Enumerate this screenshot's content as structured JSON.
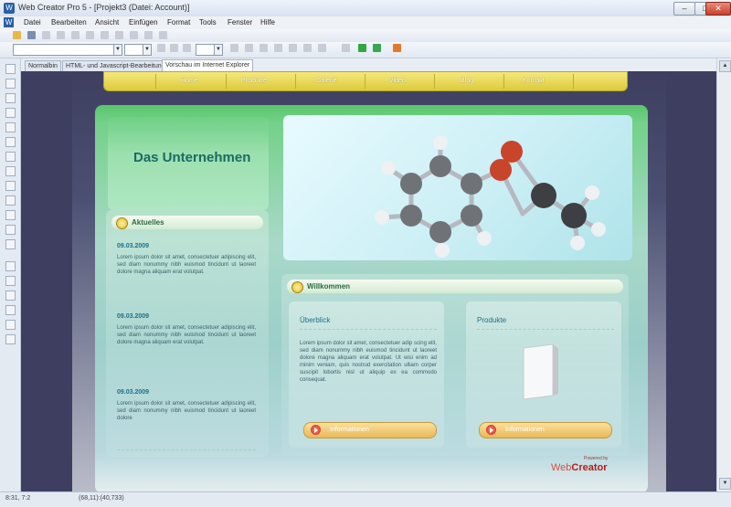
{
  "window": {
    "title": "Web Creator Pro 5 - [Projekt3 (Datei: Account)]",
    "minimize": "–",
    "maximize": "□",
    "close": "✕"
  },
  "menu": [
    "Datei",
    "Bearbeiten",
    "Ansicht",
    "Einfügen",
    "Format",
    "Tools",
    "Fenster",
    "Hilfe"
  ],
  "tabs": [
    "Normalbin",
    "HTML- und Javascript-Bearbeitung",
    "Vorschau im Internet Explorer"
  ],
  "site": {
    "nav": [
      "Home",
      "Produkte",
      "Galerie",
      "Video",
      "Blog",
      "Kontakt"
    ],
    "company_title": "Das Unternehmen",
    "news_heading": "Aktuelles",
    "news": [
      {
        "date": "09.03.2009",
        "text": "Lorem ipsum dolor sit amet, consectetuer adipiscing elit, sed diam nonummy nibh euismod tincidunt ut laoreet dolore magna aliquam erat volutpat."
      },
      {
        "date": "09.03.2009",
        "text": "Lorem ipsum dolor sit amet, consectetuer adipiscing elit, sed diam nonummy nibh euismod tincidunt ut laoreet dolore magna aliquam erat volutpat."
      },
      {
        "date": "09.03.2009",
        "text": "Lorem ipsum dolor sit amet, consectetuer adipiscing elit, sed diam nonummy nibh euismod tincidunt ut laoreet dolore"
      }
    ],
    "welcome_heading": "Willkommen",
    "overview": {
      "title": "Überblick",
      "text": "Lorem ipsum dolor sit amet, consectetuer adip scing elit, sed diam nonummy nibh euismod tincidunt ut laoreet dolore magna aliquam erat volutpat. Ut wisi enim ad minim veniam, quis nostrud exercitation ulliam corper suscipit lobortis nisl ut aliquip ex ea commodo consequat.",
      "button": "Informationen"
    },
    "products": {
      "title": "Produkte",
      "button": "Informationen"
    },
    "powered_by": "Powered by",
    "brand_web": "Web",
    "brand_creator": "Creator"
  },
  "status": {
    "left": "8:31, 7:2",
    "coords": "(68,11):(40,733)"
  },
  "colors": {
    "accent_green": "#58c66a",
    "nav_yellow": "#dccb3c",
    "brand_red": "#b81c1c"
  }
}
